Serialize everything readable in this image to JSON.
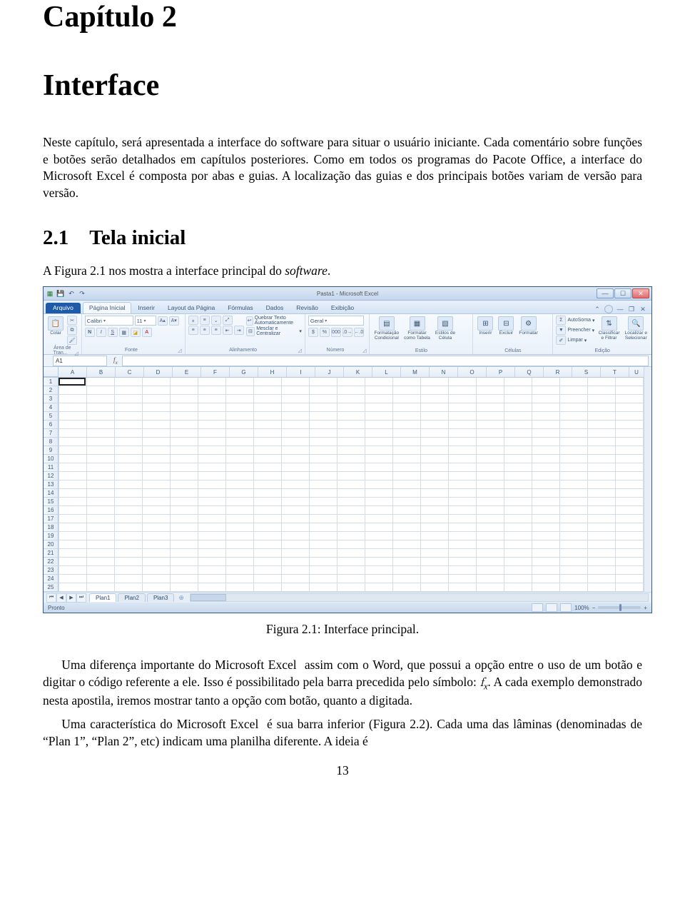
{
  "chapter_label": "Capítulo 2",
  "chapter_title": "Interface",
  "intro_paragraph": "Neste capítulo, será apresentada a interface do software para situar o usuário iniciante. Cada comentário sobre funções e botões serão detalhados em capítulos posteriores. Como em todos os programas do Pacote Office, a interface do Microsoft Excel é composta por abas e guias. A localização das guias e dos principais botões variam de versão para versão.",
  "section_2_1_heading": "2.1 Tela inicial",
  "section_2_1_para1": "A Figura 2.1 nos mostra a interface principal do software.",
  "figure_caption": "Figura 2.1: Interface principal.",
  "para_after_figure_1_a": "Uma diferença importante do Microsoft Excel  assim com o Word, que possui a opção entre o uso de um botão e digitar o código referente a ele. Isso é possibilitado pela barra precedida pelo símbolo: ",
  "para_after_figure_1_b": ". A cada exemplo demonstrado nesta apostila, iremos mostrar tanto a opção com botão, quanto a digitada.",
  "para_after_figure_2": "Uma característica do Microsoft Excel  é sua barra inferior (Figura 2.2). Cada uma das lâminas (denominadas de “Plan 1”, “Plan 2”, etc) indicam uma planilha diferente. A ideia é",
  "page_number": "13",
  "excel": {
    "titlebar_text": "Pasta1 - Microsoft Excel",
    "file_tab": "Arquivo",
    "tabs": [
      "Página Inicial",
      "Inserir",
      "Layout da Página",
      "Fórmulas",
      "Dados",
      "Revisão",
      "Exibição"
    ],
    "active_tab_index": 0,
    "ribbon": {
      "clipboard": {
        "title": "Área de Tran...",
        "paste": "Colar"
      },
      "font": {
        "title": "Fonte",
        "family": "Calibri",
        "size": "11"
      },
      "alignment": {
        "title": "Alinhamento",
        "wrap": "Quebrar Texto Automaticamente",
        "merge": "Mesclar e Centralizar"
      },
      "number": {
        "title": "Número",
        "format": "Geral",
        "currency": "$",
        "percent": "%",
        "thousand": "000"
      },
      "styles": {
        "title": "Estilo",
        "cond": "Formatação\nCondicional",
        "table": "Formatar\ncomo Tabela",
        "cell": "Estilos de\nCélula"
      },
      "cells": {
        "title": "Células",
        "insert": "Inserir",
        "delete": "Excluir",
        "format": "Formatar"
      },
      "editing": {
        "title": "Edição",
        "autosum": "AutoSoma",
        "fill": "Preencher",
        "clear": "Limpar",
        "sort": "Classificar\ne Filtrar",
        "find": "Localizar e\nSelecionar"
      }
    },
    "namebox_value": "A1",
    "columns": [
      "A",
      "B",
      "C",
      "D",
      "E",
      "F",
      "G",
      "H",
      "I",
      "J",
      "K",
      "L",
      "M",
      "N",
      "O",
      "P",
      "Q",
      "R",
      "S",
      "T",
      "U"
    ],
    "rows": [
      "1",
      "2",
      "3",
      "4",
      "5",
      "6",
      "7",
      "8",
      "9",
      "10",
      "11",
      "12",
      "13",
      "14",
      "15",
      "16",
      "17",
      "18",
      "19",
      "20",
      "21",
      "22",
      "23",
      "24",
      "25"
    ],
    "sheets": [
      "Plan1",
      "Plan2",
      "Plan3"
    ],
    "status_left": "Pronto",
    "zoom_text": "100%"
  }
}
